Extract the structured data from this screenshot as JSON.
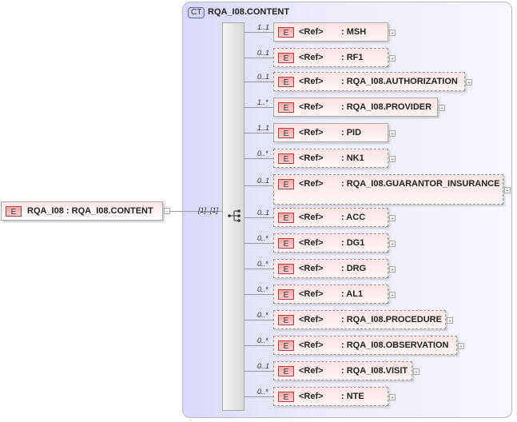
{
  "root": {
    "tag": "E",
    "label": "RQA_I08 : RQA_I08.CONTENT",
    "multiplicity": "[1]..[1]"
  },
  "complex_type": {
    "tag": "CT",
    "title": "RQA_I08.CONTENT"
  },
  "children": [
    {
      "mult": "1..1",
      "ref": "<Ref>",
      "name": ": MSH",
      "optional": false
    },
    {
      "mult": "0..1",
      "ref": "<Ref>",
      "name": ": RF1",
      "optional": true
    },
    {
      "mult": "0..1",
      "ref": "<Ref>",
      "name": ": RQA_I08.AUTHORIZATION",
      "optional": true
    },
    {
      "mult": "1..*",
      "ref": "<Ref>",
      "name": ": RQA_I08.PROVIDER",
      "optional": false
    },
    {
      "mult": "1..1",
      "ref": "<Ref>",
      "name": ": PID",
      "optional": false
    },
    {
      "mult": "0..*",
      "ref": "<Ref>",
      "name": ": NK1",
      "optional": true
    },
    {
      "mult": "0..1",
      "ref": "<Ref>",
      "name": ": RQA_I08.GUARANTOR_INSURANCE",
      "optional": true
    },
    {
      "mult": "0..1",
      "ref": "<Ref>",
      "name": ": ACC",
      "optional": true
    },
    {
      "mult": "0..*",
      "ref": "<Ref>",
      "name": ": DG1",
      "optional": true
    },
    {
      "mult": "0..*",
      "ref": "<Ref>",
      "name": ": DRG",
      "optional": true
    },
    {
      "mult": "0..*",
      "ref": "<Ref>",
      "name": ": AL1",
      "optional": true
    },
    {
      "mult": "0..*",
      "ref": "<Ref>",
      "name": ": RQA_I08.PROCEDURE",
      "optional": true
    },
    {
      "mult": "0..*",
      "ref": "<Ref>",
      "name": ": RQA_I08.OBSERVATION",
      "optional": true
    },
    {
      "mult": "0..1",
      "ref": "<Ref>",
      "name": ": RQA_I08.VISIT",
      "optional": true
    },
    {
      "mult": "0..*",
      "ref": "<Ref>",
      "name": ": NTE",
      "optional": true
    }
  ]
}
